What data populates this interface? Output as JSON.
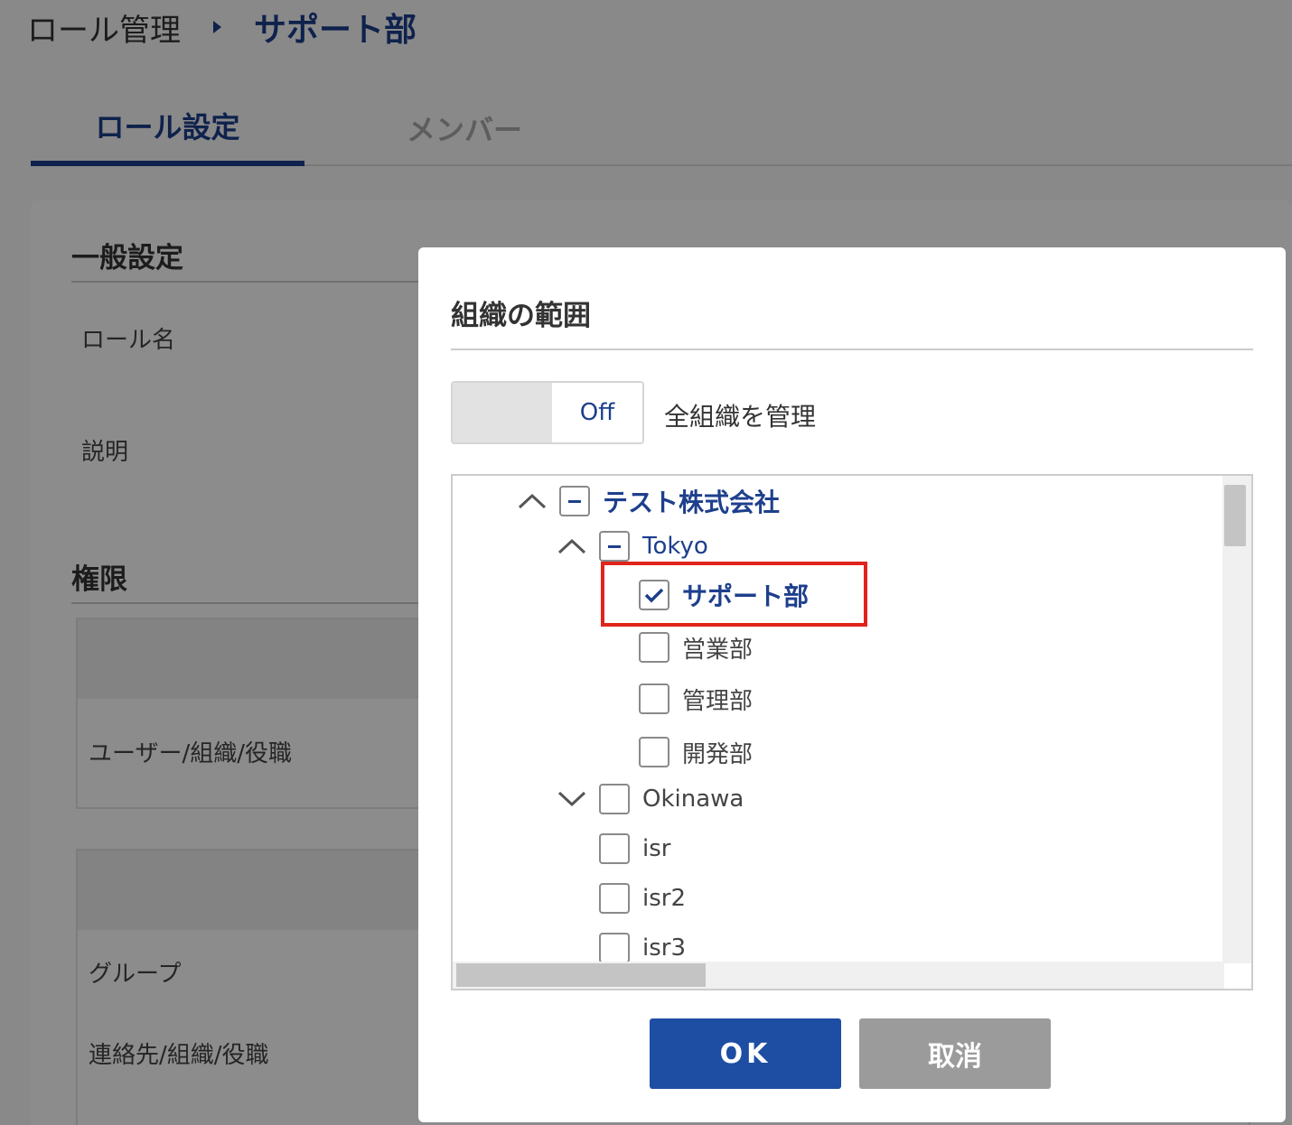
{
  "breadcrumb": {
    "root": "ロール管理",
    "current": "サポート部"
  },
  "tabs": [
    {
      "label": "ロール設定",
      "active": true
    },
    {
      "label": "メンバー",
      "active": false
    }
  ],
  "general": {
    "title": "一般設定",
    "fields": [
      {
        "label": "ロール名"
      },
      {
        "label": "説明"
      }
    ]
  },
  "permissions": {
    "title": "権限",
    "rows": [
      "ユーザー/組織/役職",
      "グループ",
      "連絡先/組織/役職"
    ]
  },
  "dialog": {
    "title": "組織の範囲",
    "toggle": {
      "state_label": "Off",
      "label": "全組織を管理"
    },
    "tree": [
      {
        "label": "テスト株式会社",
        "state": "indeterminate",
        "expand": "up"
      },
      {
        "label": "Tokyo",
        "state": "indeterminate",
        "expand": "up"
      },
      {
        "label": "サポート部",
        "state": "checked",
        "highlighted": true
      },
      {
        "label": "営業部",
        "state": "unchecked"
      },
      {
        "label": "管理部",
        "state": "unchecked"
      },
      {
        "label": "開発部",
        "state": "unchecked"
      },
      {
        "label": "Okinawa",
        "state": "unchecked",
        "expand": "down"
      },
      {
        "label": "isr",
        "state": "unchecked"
      },
      {
        "label": "isr2",
        "state": "unchecked"
      },
      {
        "label": "isr3",
        "state": "unchecked"
      }
    ],
    "buttons": {
      "ok": "OK",
      "cancel": "取消"
    }
  },
  "colors": {
    "accent": "#1d3f8c",
    "ok_button": "#1d4ea3",
    "cancel_button": "#9b9b9b",
    "highlight": "#e0241b"
  }
}
